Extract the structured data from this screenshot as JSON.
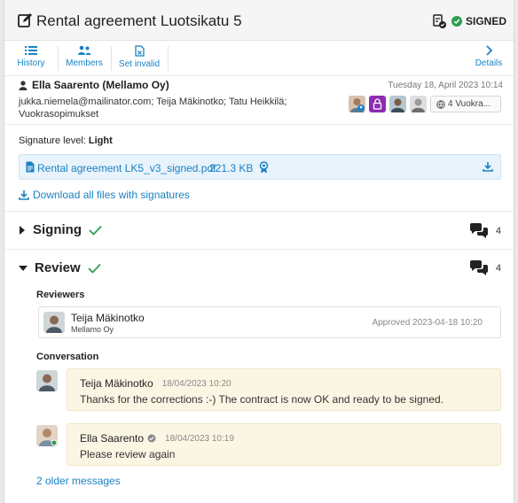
{
  "header": {
    "title": "Rental agreement Luotsikatu 5",
    "status": "SIGNED",
    "colors": {
      "accent": "#1a82c4",
      "success": "#2e9e4f",
      "lock_badge": "#8e2bb0"
    }
  },
  "toolbar": {
    "history": "History",
    "members": "Members",
    "set_invalid": "Set invalid",
    "details": "Details"
  },
  "message": {
    "sender": "Ella Saarento (Mellamo Oy)",
    "date": "Tuesday 18, April 2023 10:14",
    "recipients_line1": "jukka.niemela@mailinator.com;  Teija Mäkinotko;  Tatu Heikkilä;",
    "recipients_line2": "Vuokrasopimukset",
    "more_label": "4 Vuokra..."
  },
  "signature": {
    "label": "Signature level:",
    "level": "Light"
  },
  "file": {
    "name": "Rental agreement LK5_v3_signed.pdf",
    "size": "221.3 KB"
  },
  "download_all": "Download all files with signatures",
  "signing": {
    "title": "Signing",
    "count": "4"
  },
  "review": {
    "title": "Review",
    "count": "4",
    "reviewers_heading": "Reviewers",
    "reviewer": {
      "name": "Teija Mäkinotko",
      "org": "Mellamo Oy",
      "status": "Approved 2023-04-18 10:20"
    },
    "conversation_heading": "Conversation",
    "messages": [
      {
        "author": "Teija Mäkinotko",
        "time": "18/04/2023 10:20",
        "text": "Thanks for the corrections :-) The contract is now OK and ready to be signed."
      },
      {
        "author": "Ella Saarento",
        "time": "18/04/2023 10:19",
        "text": "Please review again"
      }
    ],
    "older_link": "2 older messages"
  }
}
